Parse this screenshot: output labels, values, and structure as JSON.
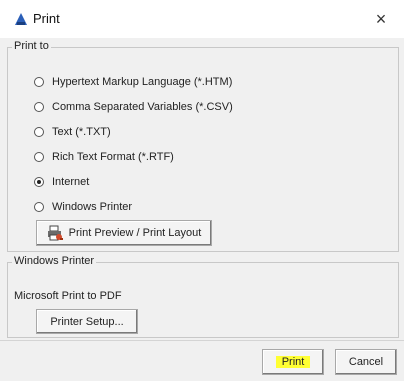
{
  "window": {
    "title": "Print",
    "close_glyph": "×",
    "icon": "print-dialog-icon"
  },
  "print_to": {
    "label": "Print to",
    "options": [
      {
        "label": "Hypertext Markup Language (*.HTM)",
        "checked": false
      },
      {
        "label": "Comma Separated Variables (*.CSV)",
        "checked": false
      },
      {
        "label": "Text (*.TXT)",
        "checked": false
      },
      {
        "label": "Rich Text Format (*.RTF)",
        "checked": false
      },
      {
        "label": "Internet",
        "checked": true
      },
      {
        "label": "Windows Printer",
        "checked": false
      }
    ],
    "preview_button": "Print Preview / Print Layout",
    "preview_icon": "print-preview-icon"
  },
  "windows_printer": {
    "label": "Windows Printer",
    "printer_name": "Microsoft Print to PDF",
    "setup_button": "Printer Setup..."
  },
  "footer": {
    "print_button": "Print",
    "cancel_button": "Cancel",
    "highlight_color": "#ffff33"
  }
}
